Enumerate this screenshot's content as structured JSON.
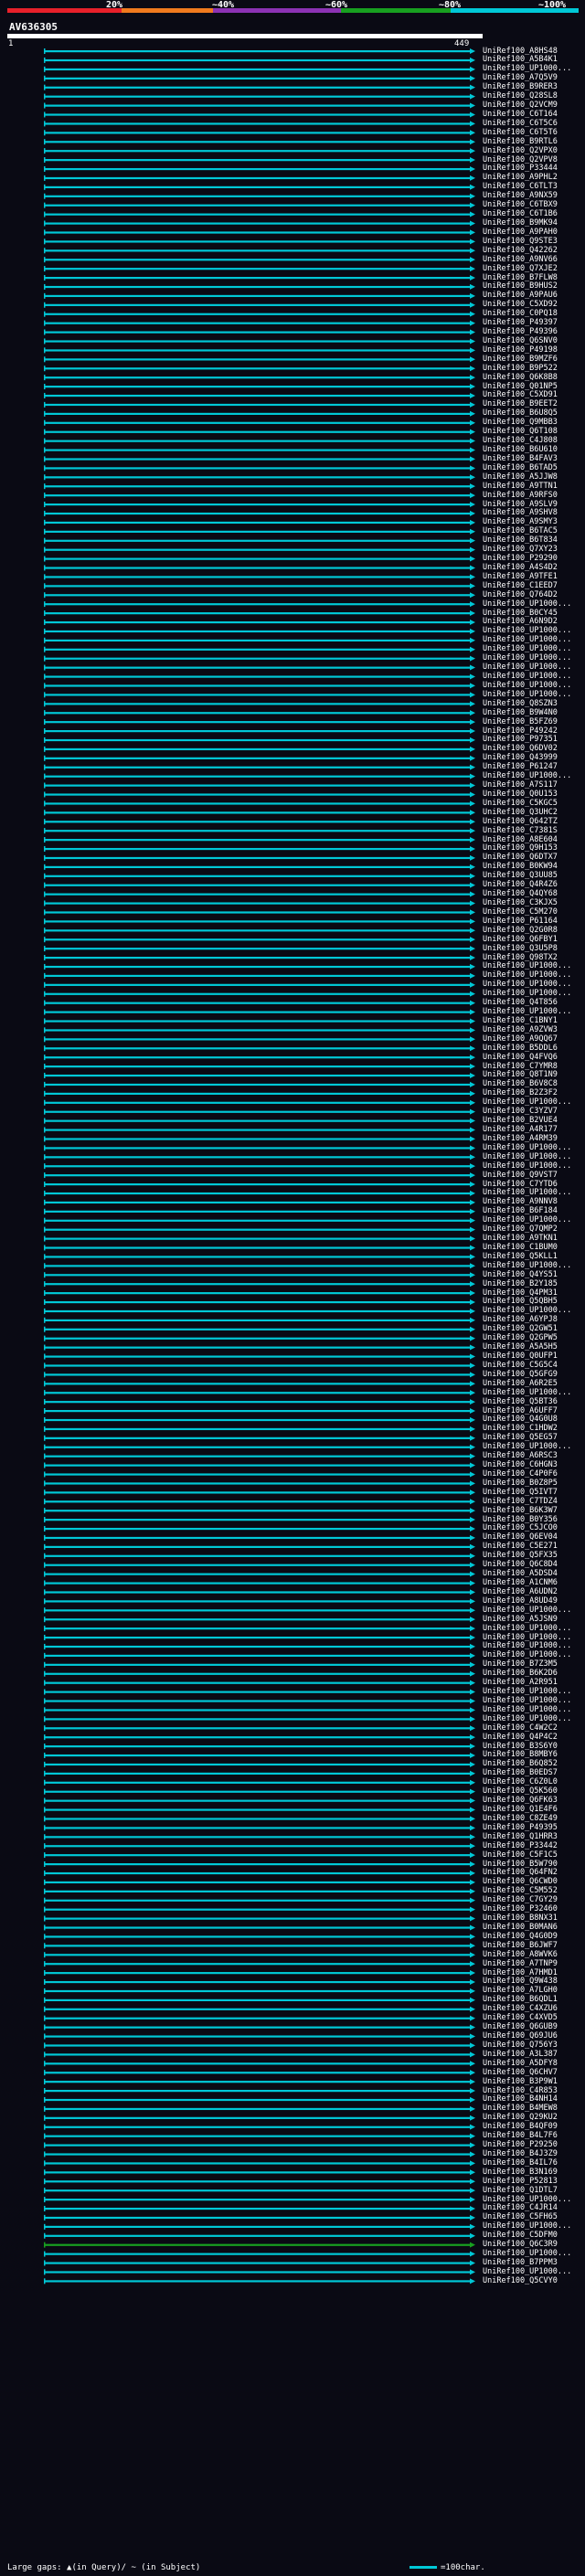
{
  "scale": {
    "labels": [
      "20%",
      "~40%",
      "~60%",
      "~80%",
      "~100%"
    ],
    "colors": [
      "#e8202a",
      "#f07a1e",
      "#8c32b4",
      "#18a020",
      "#00c8d7"
    ]
  },
  "query": {
    "title": "AV636305",
    "start": "1",
    "end": "449"
  },
  "hits": [
    "UniRef100_A8HS48",
    "UniRef100_A5B4K1",
    "UniRef100_UP1000...",
    "UniRef100_A7Q5V9",
    "UniRef100_B9RER3",
    "UniRef100_Q28SL8",
    "UniRef100_Q2VCM9",
    "UniRef100_C6T164",
    "UniRef100_C6T5C6",
    "UniRef100_C6T5T6",
    "UniRef100_B9RTL6",
    "UniRef100_Q2VPX0",
    "UniRef100_Q2VPV8",
    "UniRef100_P33444",
    "UniRef100_A9PHL2",
    "UniRef100_C6TLT3",
    "UniRef100_A9NX59",
    "UniRef100_C6TBX9",
    "UniRef100_C6T1B6",
    "UniRef100_B9MK94",
    "UniRef100_A9PAH0",
    "UniRef100_Q9STE3",
    "UniRef100_Q42262",
    "UniRef100_A9NV66",
    "UniRef100_Q7XJE2",
    "UniRef100_B7FLW8",
    "UniRef100_B9HUS2",
    "UniRef100_A9PAU6",
    "UniRef100_C5XD92",
    "UniRef100_C0PQ18",
    "UniRef100_P49397",
    "UniRef100_P49396",
    "UniRef100_Q6SNV0",
    "UniRef100_P49198",
    "UniRef100_B9MZF6",
    "UniRef100_B9P522",
    "UniRef100_Q6K8B8",
    "UniRef100_Q01NP5",
    "UniRef100_C5XD91",
    "UniRef100_B9EET2",
    "UniRef100_B6U8Q5",
    "UniRef100_Q9MBB3",
    "UniRef100_Q6T108",
    "UniRef100_C4J808",
    "UniRef100_B6U610",
    "UniRef100_B4FAV3",
    "UniRef100_B6TAD5",
    "UniRef100_A5JJW8",
    "UniRef100_A9TTN1",
    "UniRef100_A9RFS0",
    "UniRef100_A9SLV9",
    "UniRef100_A9SHV8",
    "UniRef100_A9SMY3",
    "UniRef100_B6TAC5",
    "UniRef100_B6T834",
    "UniRef100_Q7XY23",
    "UniRef100_P29290",
    "UniRef100_A4S4D2",
    "UniRef100_A9TFE1",
    "UniRef100_C1EED7",
    "UniRef100_Q764D2",
    "UniRef100_UP1000...",
    "UniRef100_B0CY45",
    "UniRef100_A6N9D2",
    "UniRef100_UP1000...",
    "UniRef100_UP1000...",
    "UniRef100_UP1000...",
    "UniRef100_UP1000...",
    "UniRef100_UP1000...",
    "UniRef100_UP1000...",
    "UniRef100_UP1000...",
    "UniRef100_UP1000...",
    "UniRef100_Q8SZN3",
    "UniRef100_B9W4N0",
    "UniRef100_B5FZ69",
    "UniRef100_P49242",
    "UniRef100_P97351",
    "UniRef100_Q6DV02",
    "UniRef100_Q43999",
    "UniRef100_P61247",
    "UniRef100_UP1000...",
    "UniRef100_A7S117",
    "UniRef100_Q0U153",
    "UniRef100_C5KGC5",
    "UniRef100_Q3UHC2",
    "UniRef100_Q642TZ",
    "UniRef100_C7381S",
    "UniRef100_A8E604",
    "UniRef100_Q9H153",
    "UniRef100_Q6DTX7",
    "UniRef100_B0KW94",
    "UniRef100_Q3UU85",
    "UniRef100_Q4R4Z6",
    "UniRef100_Q4QY68",
    "UniRef100_C3KJX5",
    "UniRef100_C5M270",
    "UniRef100_P61164",
    "UniRef100_Q2G0R8",
    "UniRef100_Q6FBY1",
    "UniRef100_Q3U5P8",
    "UniRef100_Q98TX2",
    "UniRef100_UP1000...",
    "UniRef100_UP1000...",
    "UniRef100_UP1000...",
    "UniRef100_UP1000...",
    "UniRef100_Q4T856",
    "UniRef100_UP1000...",
    "UniRef100_C1BNY1",
    "UniRef100_A9ZVW3",
    "UniRef100_A9QQ67",
    "UniRef100_B5DDL6",
    "UniRef100_Q4FVQ6",
    "UniRef100_C7YMR8",
    "UniRef100_Q8T1N9",
    "UniRef100_B6V8C8",
    "UniRef100_B2Z3F2",
    "UniRef100_UP1000...",
    "UniRef100_C3YZV7",
    "UniRef100_B2VUE4",
    "UniRef100_A4R177",
    "UniRef100_A4RM39",
    "UniRef100_UP1000...",
    "UniRef100_UP1000...",
    "UniRef100_UP1000...",
    "UniRef100_Q9VST7",
    "UniRef100_C7YTD6",
    "UniRef100_UP1000...",
    "UniRef100_A9NNV8",
    "UniRef100_B6F184",
    "UniRef100_UP1000...",
    "UniRef100_Q7QMP2",
    "UniRef100_A9TKN1",
    "UniRef100_C1BUM0",
    "UniRef100_Q5KLL1",
    "UniRef100_UP1000...",
    "UniRef100_Q4YS51",
    "UniRef100_B2Y185",
    "UniRef100_Q4PM31",
    "UniRef100_Q5QBH5",
    "UniRef100_UP1000...",
    "UniRef100_A6YPJ8",
    "UniRef100_Q2GW51",
    "UniRef100_Q2GPW5",
    "UniRef100_A5A5H5",
    "UniRef100_Q0UFP1",
    "UniRef100_C5G5C4",
    "UniRef100_Q5GFG9",
    "UniRef100_A6R2E5",
    "UniRef100_UP1000...",
    "UniRef100_Q5BT36",
    "UniRef100_A6UFF7",
    "UniRef100_Q4G0U8",
    "UniRef100_C1HDW2",
    "UniRef100_Q5EG57",
    "UniRef100_UP1000...",
    "UniRef100_A6RSC3",
    "UniRef100_C6HGN3",
    "UniRef100_C4P0F6",
    "UniRef100_B0Z8P5",
    "UniRef100_Q5IVT7",
    "UniRef100_C7TDZ4",
    "UniRef100_B6K3W7",
    "UniRef100_B0Y356",
    "UniRef100_C5JCO0",
    "UniRef100_Q6EV04",
    "UniRef100_C5E271",
    "UniRef100_Q5FX35",
    "UniRef100_Q6C8D4",
    "UniRef100_A5DSD4",
    "UniRef100_A1CNM6",
    "UniRef100_A6UDN2",
    "UniRef100_A8UD49",
    "UniRef100_UP1000...",
    "UniRef100_A5JSN9",
    "UniRef100_UP1000...",
    "UniRef100_UP1000...",
    "UniRef100_UP1000...",
    "UniRef100_UP1000...",
    "UniRef100_B7Z3M5",
    "UniRef100_B6K2D6",
    "UniRef100_A2R951",
    "UniRef100_UP1000...",
    "UniRef100_UP1000...",
    "UniRef100_UP1000...",
    "UniRef100_UP1000...",
    "UniRef100_C4W2C2",
    "UniRef100_Q4P4C2",
    "UniRef100_B3S6Y0",
    "UniRef100_B8MBY6",
    "UniRef100_B6Q852",
    "UniRef100_B0EDS7",
    "UniRef100_C6Z0L0",
    "UniRef100_Q5K560",
    "UniRef100_Q6FK63",
    "UniRef100_Q1E4F6",
    "UniRef100_C8ZE49",
    "UniRef100_P49395",
    "UniRef100_Q1HRR3",
    "UniRef100_P33442",
    "UniRef100_C5F1C5",
    "UniRef100_B5W790",
    "UniRef100_Q64FN2",
    "UniRef100_Q6CWD0",
    "UniRef100_C5M552",
    "UniRef100_C7GY29",
    "UniRef100_P32460",
    "UniRef100_B8NX31",
    "UniRef100_B0MAN6",
    "UniRef100_Q4G0D9",
    "UniRef100_B6JWF7",
    "UniRef100_A8WVK6",
    "UniRef100_A7TNP9",
    "UniRef100_A7HMD1",
    "UniRef100_Q9W438",
    "UniRef100_A7LGH0",
    "UniRef100_B6QDL1",
    "UniRef100_C4XZU6",
    "UniRef100_C4XVD5",
    "UniRef100_Q6GUB9",
    "UniRef100_Q69JU6",
    "UniRef100_Q756Y3",
    "UniRef100_A3L387",
    "UniRef100_A5DFY8",
    "UniRef100_Q6CHV7",
    "UniRef100_B3P9W1",
    "UniRef100_C4R853",
    "UniRef100_B4NH14",
    "UniRef100_B4MEW8",
    "UniRef100_Q29KU2",
    "UniRef100_B4QF09",
    "UniRef100_B4L7F6",
    "UniRef100_P29250",
    "UniRef100_B4J3Z9",
    "UniRef100_B4IL76",
    "UniRef100_B3N169",
    "UniRef100_P52813",
    "UniRef100_Q1DTL7",
    "UniRef100_UP1000...",
    "UniRef100_C4JR14",
    "UniRef100_C5FH65",
    "UniRef100_UP1000...",
    "UniRef100_C5DFM0",
    "UniRef100_Q6C3R9",
    "UniRef100_UP1000...",
    "UniRef100_B7PPM3",
    "UniRef100_UP1000...",
    "UniRef100_Q5CVY0"
  ],
  "footer": {
    "gaps_label": "Large gaps: ▲(in Query)/ ~ (in Subject)",
    "legend_label": "=100char."
  }
}
